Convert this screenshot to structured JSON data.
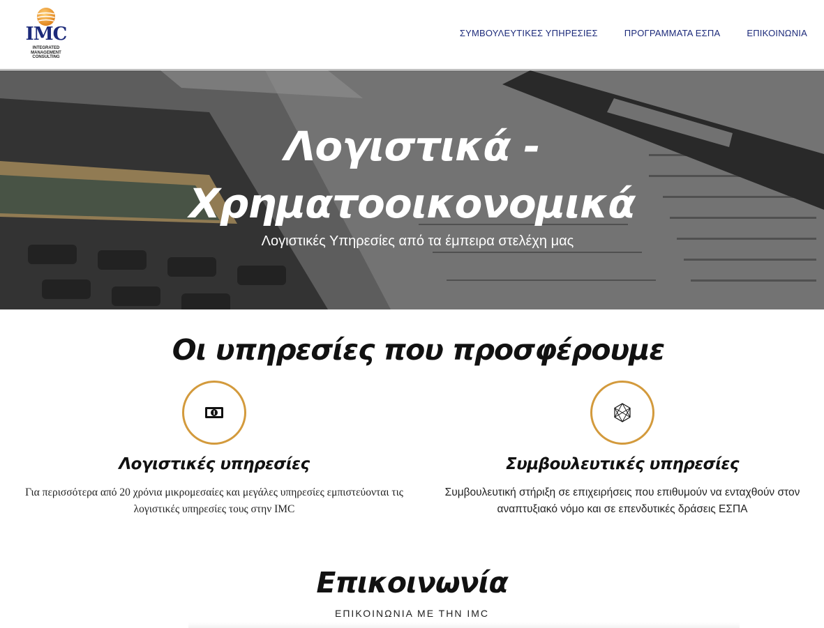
{
  "header": {
    "logo": {
      "text": "IMC",
      "subtitle_lines": [
        "INTEGRATED",
        "MANAGEMENT",
        "CONSULTING"
      ]
    },
    "nav": [
      {
        "label": "ΣΥΜΒΟΥΛΕΥΤΙΚΕΣ ΥΠΗΡΕΣΙΕΣ"
      },
      {
        "label": "ΠΡΟΓΡΑΜΜΑΤΑ ΕΣΠΑ"
      },
      {
        "label": "ΕΠΙΚΟΙΝΩΝΙΑ"
      }
    ]
  },
  "hero": {
    "title_line1": "Λογιστικά -",
    "title_line2": "Χρηματοοικονομικά",
    "subtitle": "Λογιστικές Υπηρεσίες από τα έμπειρα στελέχη μας"
  },
  "services": {
    "title": "Οι υπηρεσίες που προσφέρουμε",
    "items": [
      {
        "icon": "money-bill-icon",
        "heading": "Λογιστικές υπηρεσίες",
        "text": "Για περισσότερα από 20 χρόνια μικρομεσαίες και μεγάλες υπηρεσίες εμπιστεύονται τις λογιστικές υπηρεσίες τους στην IMC"
      },
      {
        "icon": "network-hexagon-icon",
        "heading": "Συμβουλευτικές υπηρεσίες",
        "text": "Συμβουλευτική στήριξη σε επιχειρήσεις που επιθυμούν να ενταχθούν στον αναπτυξιακό νόμο και σε επενδυτικές δράσεις ΕΣΠΑ"
      }
    ]
  },
  "contact": {
    "title": "Επικοινωνία",
    "subtitle": "ΕΠΙΚΟΙΝΩΝΙΑ ΜΕ ΤΗΝ IMC"
  },
  "colors": {
    "brand_navy": "#1c2a7a",
    "accent_gold": "#d39a3c",
    "globe_orange": "#e8962e"
  }
}
